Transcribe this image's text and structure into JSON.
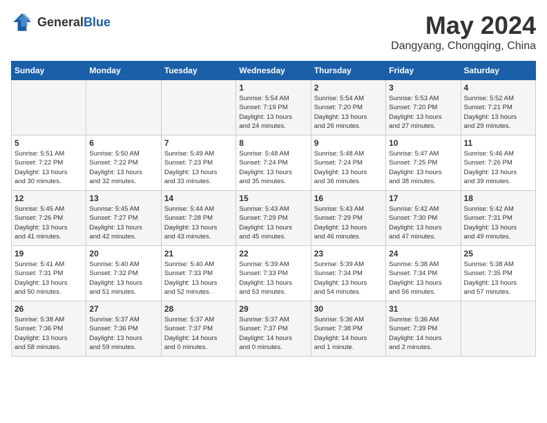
{
  "header": {
    "logo_general": "General",
    "logo_blue": "Blue",
    "month_title": "May 2024",
    "location": "Dangyang, Chongqing, China"
  },
  "days_of_week": [
    "Sunday",
    "Monday",
    "Tuesday",
    "Wednesday",
    "Thursday",
    "Friday",
    "Saturday"
  ],
  "weeks": [
    [
      {
        "day": "",
        "info": ""
      },
      {
        "day": "",
        "info": ""
      },
      {
        "day": "",
        "info": ""
      },
      {
        "day": "1",
        "info": "Sunrise: 5:54 AM\nSunset: 7:19 PM\nDaylight: 13 hours\nand 24 minutes."
      },
      {
        "day": "2",
        "info": "Sunrise: 5:54 AM\nSunset: 7:20 PM\nDaylight: 13 hours\nand 26 minutes."
      },
      {
        "day": "3",
        "info": "Sunrise: 5:53 AM\nSunset: 7:20 PM\nDaylight: 13 hours\nand 27 minutes."
      },
      {
        "day": "4",
        "info": "Sunrise: 5:52 AM\nSunset: 7:21 PM\nDaylight: 13 hours\nand 29 minutes."
      }
    ],
    [
      {
        "day": "5",
        "info": "Sunrise: 5:51 AM\nSunset: 7:22 PM\nDaylight: 13 hours\nand 30 minutes."
      },
      {
        "day": "6",
        "info": "Sunrise: 5:50 AM\nSunset: 7:22 PM\nDaylight: 13 hours\nand 32 minutes."
      },
      {
        "day": "7",
        "info": "Sunrise: 5:49 AM\nSunset: 7:23 PM\nDaylight: 13 hours\nand 33 minutes."
      },
      {
        "day": "8",
        "info": "Sunrise: 5:48 AM\nSunset: 7:24 PM\nDaylight: 13 hours\nand 35 minutes."
      },
      {
        "day": "9",
        "info": "Sunrise: 5:48 AM\nSunset: 7:24 PM\nDaylight: 13 hours\nand 36 minutes."
      },
      {
        "day": "10",
        "info": "Sunrise: 5:47 AM\nSunset: 7:25 PM\nDaylight: 13 hours\nand 38 minutes."
      },
      {
        "day": "11",
        "info": "Sunrise: 5:46 AM\nSunset: 7:26 PM\nDaylight: 13 hours\nand 39 minutes."
      }
    ],
    [
      {
        "day": "12",
        "info": "Sunrise: 5:45 AM\nSunset: 7:26 PM\nDaylight: 13 hours\nand 41 minutes."
      },
      {
        "day": "13",
        "info": "Sunrise: 5:45 AM\nSunset: 7:27 PM\nDaylight: 13 hours\nand 42 minutes."
      },
      {
        "day": "14",
        "info": "Sunrise: 5:44 AM\nSunset: 7:28 PM\nDaylight: 13 hours\nand 43 minutes."
      },
      {
        "day": "15",
        "info": "Sunrise: 5:43 AM\nSunset: 7:29 PM\nDaylight: 13 hours\nand 45 minutes."
      },
      {
        "day": "16",
        "info": "Sunrise: 5:43 AM\nSunset: 7:29 PM\nDaylight: 13 hours\nand 46 minutes."
      },
      {
        "day": "17",
        "info": "Sunrise: 5:42 AM\nSunset: 7:30 PM\nDaylight: 13 hours\nand 47 minutes."
      },
      {
        "day": "18",
        "info": "Sunrise: 5:42 AM\nSunset: 7:31 PM\nDaylight: 13 hours\nand 49 minutes."
      }
    ],
    [
      {
        "day": "19",
        "info": "Sunrise: 5:41 AM\nSunset: 7:31 PM\nDaylight: 13 hours\nand 50 minutes."
      },
      {
        "day": "20",
        "info": "Sunrise: 5:40 AM\nSunset: 7:32 PM\nDaylight: 13 hours\nand 51 minutes."
      },
      {
        "day": "21",
        "info": "Sunrise: 5:40 AM\nSunset: 7:33 PM\nDaylight: 13 hours\nand 52 minutes."
      },
      {
        "day": "22",
        "info": "Sunrise: 5:39 AM\nSunset: 7:33 PM\nDaylight: 13 hours\nand 53 minutes."
      },
      {
        "day": "23",
        "info": "Sunrise: 5:39 AM\nSunset: 7:34 PM\nDaylight: 13 hours\nand 54 minutes."
      },
      {
        "day": "24",
        "info": "Sunrise: 5:38 AM\nSunset: 7:34 PM\nDaylight: 13 hours\nand 56 minutes."
      },
      {
        "day": "25",
        "info": "Sunrise: 5:38 AM\nSunset: 7:35 PM\nDaylight: 13 hours\nand 57 minutes."
      }
    ],
    [
      {
        "day": "26",
        "info": "Sunrise: 5:38 AM\nSunset: 7:36 PM\nDaylight: 13 hours\nand 58 minutes."
      },
      {
        "day": "27",
        "info": "Sunrise: 5:37 AM\nSunset: 7:36 PM\nDaylight: 13 hours\nand 59 minutes."
      },
      {
        "day": "28",
        "info": "Sunrise: 5:37 AM\nSunset: 7:37 PM\nDaylight: 14 hours\nand 0 minutes."
      },
      {
        "day": "29",
        "info": "Sunrise: 5:37 AM\nSunset: 7:37 PM\nDaylight: 14 hours\nand 0 minutes."
      },
      {
        "day": "30",
        "info": "Sunrise: 5:36 AM\nSunset: 7:38 PM\nDaylight: 14 hours\nand 1 minute."
      },
      {
        "day": "31",
        "info": "Sunrise: 5:36 AM\nSunset: 7:39 PM\nDaylight: 14 hours\nand 2 minutes."
      },
      {
        "day": "",
        "info": ""
      }
    ]
  ]
}
